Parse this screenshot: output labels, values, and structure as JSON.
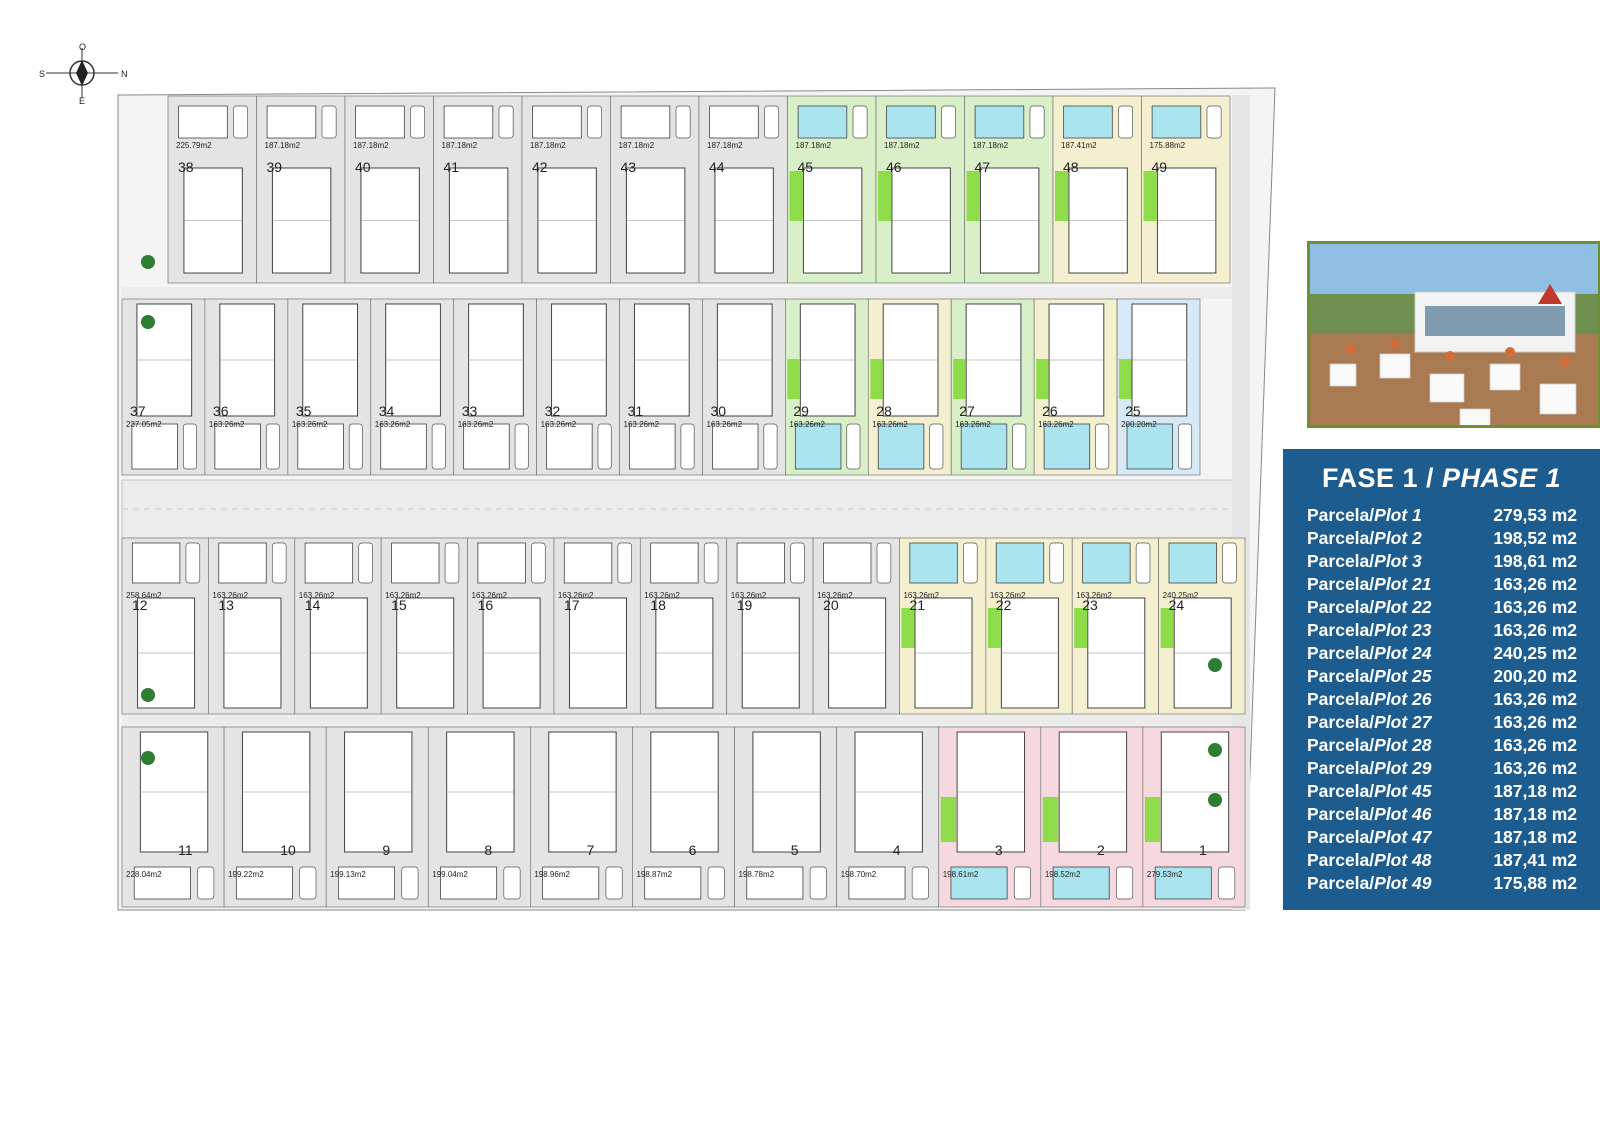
{
  "compass": {
    "north": "N",
    "south": "S",
    "east": "E",
    "west": "O"
  },
  "photo": {
    "description_icon": "restaurant-terrace-photo"
  },
  "phase": {
    "title_es": "FASE 1 /",
    "title_en": "PHASE 1",
    "plots": [
      {
        "label_es": "Parcela/",
        "label_en": "Plot 1",
        "area": "279,53 m2"
      },
      {
        "label_es": "Parcela/",
        "label_en": "Plot 2",
        "area": "198,52 m2"
      },
      {
        "label_es": "Parcela/",
        "label_en": "Plot 3",
        "area": "198,61 m2"
      },
      {
        "label_es": "Parcela/",
        "label_en": "Plot 21",
        "area": "163,26 m2"
      },
      {
        "label_es": "Parcela/",
        "label_en": "Plot 22",
        "area": "163,26 m2"
      },
      {
        "label_es": "Parcela/",
        "label_en": "Plot 23",
        "area": "163,26 m2"
      },
      {
        "label_es": "Parcela/",
        "label_en": "Plot 24",
        "area": "240,25 m2"
      },
      {
        "label_es": "Parcela/",
        "label_en": "Plot 25",
        "area": "200,20 m2"
      },
      {
        "label_es": "Parcela/",
        "label_en": "Plot 26",
        "area": "163,26 m2"
      },
      {
        "label_es": "Parcela/",
        "label_en": "Plot 27",
        "area": "163,26 m2"
      },
      {
        "label_es": "Parcela/",
        "label_en": "Plot 28",
        "area": "163,26 m2"
      },
      {
        "label_es": "Parcela/",
        "label_en": "Plot 29",
        "area": "163,26 m2"
      },
      {
        "label_es": "Parcela/",
        "label_en": "Plot 45",
        "area": "187,18 m2"
      },
      {
        "label_es": "Parcela/",
        "label_en": "Plot 46",
        "area": "187,18 m2"
      },
      {
        "label_es": "Parcela/",
        "label_en": "Plot 47",
        "area": "187,18 m2"
      },
      {
        "label_es": "Parcela/",
        "label_en": "Plot 48",
        "area": "187,41 m2"
      },
      {
        "label_es": "Parcela/",
        "label_en": "Plot 49",
        "area": "175,88 m2"
      }
    ]
  },
  "plan": {
    "colors": {
      "green_lot": "#d9efc8",
      "yellow_lot": "#f3efcf",
      "pink_lot": "#f6d9de",
      "blue_lot": "#d6e9f4",
      "grey_lot": "#e4e4e4",
      "pool": "#a9e4ef",
      "lawn": "#8fdc4a",
      "panel": "#1c5c8f",
      "street": "#ededed"
    },
    "row1": [
      {
        "num": "38",
        "area": "225.79m2",
        "color": "grey"
      },
      {
        "num": "39",
        "area": "187.18m2",
        "color": "grey"
      },
      {
        "num": "40",
        "area": "187.18m2",
        "color": "grey"
      },
      {
        "num": "41",
        "area": "187.18m2",
        "color": "grey"
      },
      {
        "num": "42",
        "area": "187.18m2",
        "color": "grey"
      },
      {
        "num": "43",
        "area": "187.18m2",
        "color": "grey"
      },
      {
        "num": "44",
        "area": "187.18m2",
        "color": "grey"
      },
      {
        "num": "45",
        "area": "187.18m2",
        "color": "green"
      },
      {
        "num": "46",
        "area": "187.18m2",
        "color": "green"
      },
      {
        "num": "47",
        "area": "187.18m2",
        "color": "green"
      },
      {
        "num": "48",
        "area": "187.41m2",
        "color": "yellow"
      },
      {
        "num": "49",
        "area": "175.88m2",
        "color": "yellow"
      }
    ],
    "row2": [
      {
        "num": "37",
        "area": "237.05m2",
        "color": "grey"
      },
      {
        "num": "36",
        "area": "163.26m2",
        "color": "grey"
      },
      {
        "num": "35",
        "area": "163.26m2",
        "color": "grey"
      },
      {
        "num": "34",
        "area": "163.26m2",
        "color": "grey"
      },
      {
        "num": "33",
        "area": "163.26m2",
        "color": "grey"
      },
      {
        "num": "32",
        "area": "163.26m2",
        "color": "grey"
      },
      {
        "num": "31",
        "area": "163.26m2",
        "color": "grey"
      },
      {
        "num": "30",
        "area": "163.26m2",
        "color": "grey"
      },
      {
        "num": "29",
        "area": "163.26m2",
        "color": "green"
      },
      {
        "num": "28",
        "area": "163.26m2",
        "color": "yellow"
      },
      {
        "num": "27",
        "area": "163.26m2",
        "color": "green"
      },
      {
        "num": "26",
        "area": "163.26m2",
        "color": "yellow"
      },
      {
        "num": "25",
        "area": "200.20m2",
        "color": "blue"
      }
    ],
    "row3": [
      {
        "num": "12",
        "area": "258.64m2",
        "color": "grey"
      },
      {
        "num": "13",
        "area": "163.26m2",
        "color": "grey"
      },
      {
        "num": "14",
        "area": "163.26m2",
        "color": "grey"
      },
      {
        "num": "15",
        "area": "163.26m2",
        "color": "grey"
      },
      {
        "num": "16",
        "area": "163.26m2",
        "color": "grey"
      },
      {
        "num": "17",
        "area": "163.26m2",
        "color": "grey"
      },
      {
        "num": "18",
        "area": "163.26m2",
        "color": "grey"
      },
      {
        "num": "19",
        "area": "163.26m2",
        "color": "grey"
      },
      {
        "num": "20",
        "area": "163.26m2",
        "color": "grey"
      },
      {
        "num": "21",
        "area": "163.26m2",
        "color": "yellow"
      },
      {
        "num": "22",
        "area": "163.26m2",
        "color": "yellow"
      },
      {
        "num": "23",
        "area": "163.26m2",
        "color": "yellow"
      },
      {
        "num": "24",
        "area": "240.25m2",
        "color": "yellow"
      }
    ],
    "row4": [
      {
        "num": "11",
        "area": "228.04m2",
        "color": "grey"
      },
      {
        "num": "10",
        "area": "199.22m2",
        "color": "grey"
      },
      {
        "num": "9",
        "area": "199.13m2",
        "color": "grey"
      },
      {
        "num": "8",
        "area": "199.04m2",
        "color": "grey"
      },
      {
        "num": "7",
        "area": "198.96m2",
        "color": "grey"
      },
      {
        "num": "6",
        "area": "198.87m2",
        "color": "grey"
      },
      {
        "num": "5",
        "area": "198.78m2",
        "color": "grey"
      },
      {
        "num": "4",
        "area": "198.70m2",
        "color": "grey"
      },
      {
        "num": "3",
        "area": "198.61m2",
        "color": "pink"
      },
      {
        "num": "2",
        "area": "198.52m2",
        "color": "pink"
      },
      {
        "num": "1",
        "area": "279.53m2",
        "color": "pink"
      }
    ]
  }
}
